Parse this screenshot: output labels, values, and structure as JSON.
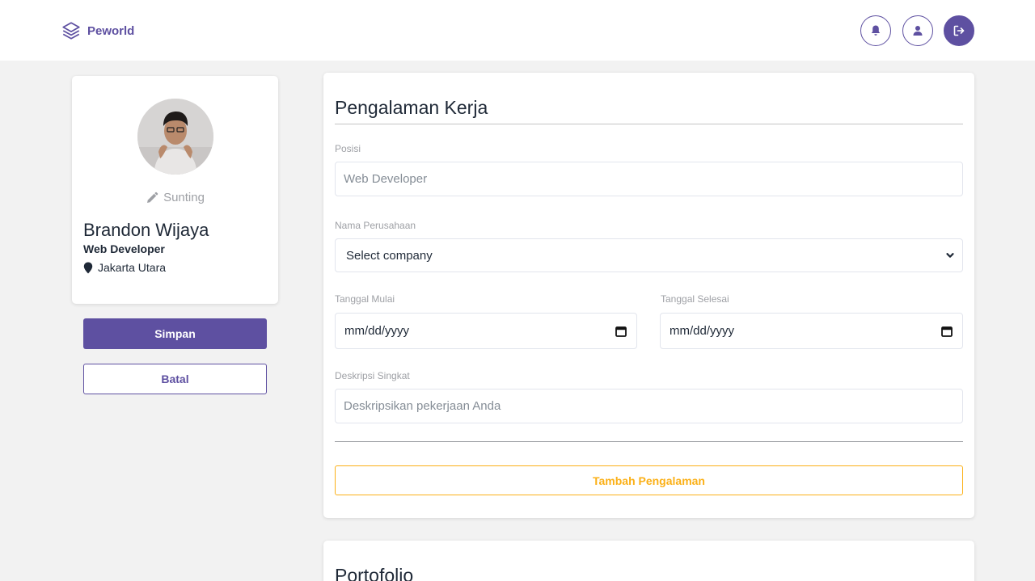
{
  "brand": {
    "name": "Peworld",
    "logo_icon": "layers-icon",
    "color": "#5e50a1"
  },
  "nav": {
    "buttons": [
      {
        "name": "notification-button",
        "icon": "bell-icon"
      },
      {
        "name": "profile-button",
        "icon": "user-icon"
      },
      {
        "name": "logout-button",
        "icon": "logout-icon"
      }
    ]
  },
  "profile": {
    "edit_label": "Sunting",
    "name": "Brandon Wijaya",
    "job": "Web Developer",
    "location": "Jakarta Utara"
  },
  "actions": {
    "save_label": "Simpan",
    "cancel_label": "Batal"
  },
  "experience": {
    "title": "Pengalaman Kerja",
    "position_label": "Posisi",
    "position_placeholder": "Web Developer",
    "company_label": "Nama Perusahaan",
    "company_selected": "Select company",
    "start_label": "Tanggal Mulai",
    "start_value": "mm/dd/yyyy",
    "end_label": "Tanggal Selesai",
    "end_value": "mm/dd/yyyy",
    "desc_label": "Deskripsi Singkat",
    "desc_placeholder": "Deskripsikan pekerjaan Anda",
    "add_label": "Tambah Pengalaman"
  },
  "portfolio": {
    "title": "Portofolio"
  },
  "colors": {
    "primary": "#5e50a1",
    "accent": "#fbb017",
    "muted": "#9ea0a5",
    "background": "#f2f2f2"
  }
}
